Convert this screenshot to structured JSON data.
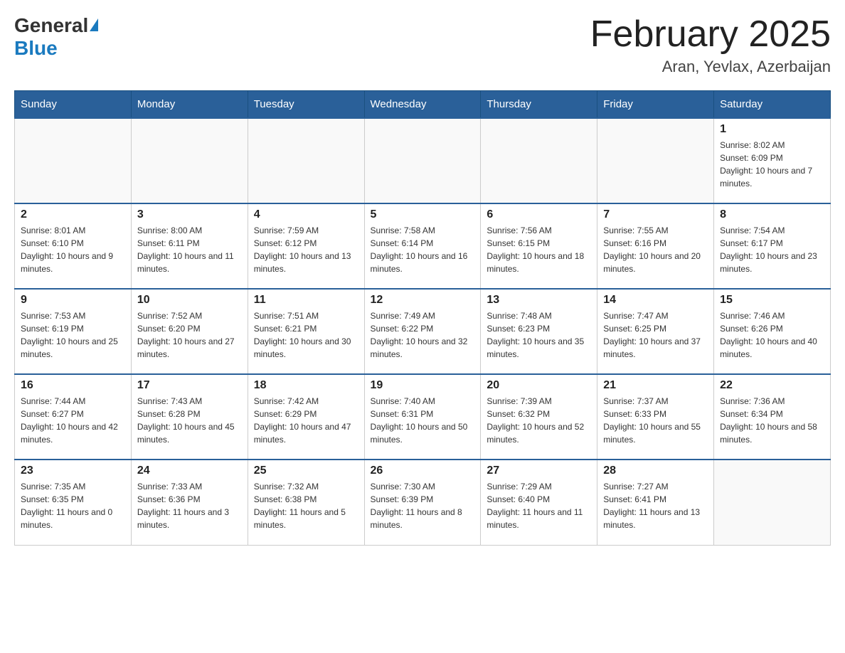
{
  "header": {
    "logo_general": "General",
    "logo_blue": "Blue",
    "title": "February 2025",
    "subtitle": "Aran, Yevlax, Azerbaijan"
  },
  "days_of_week": [
    "Sunday",
    "Monday",
    "Tuesday",
    "Wednesday",
    "Thursday",
    "Friday",
    "Saturday"
  ],
  "weeks": [
    [
      {
        "day": "",
        "info": ""
      },
      {
        "day": "",
        "info": ""
      },
      {
        "day": "",
        "info": ""
      },
      {
        "day": "",
        "info": ""
      },
      {
        "day": "",
        "info": ""
      },
      {
        "day": "",
        "info": ""
      },
      {
        "day": "1",
        "info": "Sunrise: 8:02 AM\nSunset: 6:09 PM\nDaylight: 10 hours and 7 minutes."
      }
    ],
    [
      {
        "day": "2",
        "info": "Sunrise: 8:01 AM\nSunset: 6:10 PM\nDaylight: 10 hours and 9 minutes."
      },
      {
        "day": "3",
        "info": "Sunrise: 8:00 AM\nSunset: 6:11 PM\nDaylight: 10 hours and 11 minutes."
      },
      {
        "day": "4",
        "info": "Sunrise: 7:59 AM\nSunset: 6:12 PM\nDaylight: 10 hours and 13 minutes."
      },
      {
        "day": "5",
        "info": "Sunrise: 7:58 AM\nSunset: 6:14 PM\nDaylight: 10 hours and 16 minutes."
      },
      {
        "day": "6",
        "info": "Sunrise: 7:56 AM\nSunset: 6:15 PM\nDaylight: 10 hours and 18 minutes."
      },
      {
        "day": "7",
        "info": "Sunrise: 7:55 AM\nSunset: 6:16 PM\nDaylight: 10 hours and 20 minutes."
      },
      {
        "day": "8",
        "info": "Sunrise: 7:54 AM\nSunset: 6:17 PM\nDaylight: 10 hours and 23 minutes."
      }
    ],
    [
      {
        "day": "9",
        "info": "Sunrise: 7:53 AM\nSunset: 6:19 PM\nDaylight: 10 hours and 25 minutes."
      },
      {
        "day": "10",
        "info": "Sunrise: 7:52 AM\nSunset: 6:20 PM\nDaylight: 10 hours and 27 minutes."
      },
      {
        "day": "11",
        "info": "Sunrise: 7:51 AM\nSunset: 6:21 PM\nDaylight: 10 hours and 30 minutes."
      },
      {
        "day": "12",
        "info": "Sunrise: 7:49 AM\nSunset: 6:22 PM\nDaylight: 10 hours and 32 minutes."
      },
      {
        "day": "13",
        "info": "Sunrise: 7:48 AM\nSunset: 6:23 PM\nDaylight: 10 hours and 35 minutes."
      },
      {
        "day": "14",
        "info": "Sunrise: 7:47 AM\nSunset: 6:25 PM\nDaylight: 10 hours and 37 minutes."
      },
      {
        "day": "15",
        "info": "Sunrise: 7:46 AM\nSunset: 6:26 PM\nDaylight: 10 hours and 40 minutes."
      }
    ],
    [
      {
        "day": "16",
        "info": "Sunrise: 7:44 AM\nSunset: 6:27 PM\nDaylight: 10 hours and 42 minutes."
      },
      {
        "day": "17",
        "info": "Sunrise: 7:43 AM\nSunset: 6:28 PM\nDaylight: 10 hours and 45 minutes."
      },
      {
        "day": "18",
        "info": "Sunrise: 7:42 AM\nSunset: 6:29 PM\nDaylight: 10 hours and 47 minutes."
      },
      {
        "day": "19",
        "info": "Sunrise: 7:40 AM\nSunset: 6:31 PM\nDaylight: 10 hours and 50 minutes."
      },
      {
        "day": "20",
        "info": "Sunrise: 7:39 AM\nSunset: 6:32 PM\nDaylight: 10 hours and 52 minutes."
      },
      {
        "day": "21",
        "info": "Sunrise: 7:37 AM\nSunset: 6:33 PM\nDaylight: 10 hours and 55 minutes."
      },
      {
        "day": "22",
        "info": "Sunrise: 7:36 AM\nSunset: 6:34 PM\nDaylight: 10 hours and 58 minutes."
      }
    ],
    [
      {
        "day": "23",
        "info": "Sunrise: 7:35 AM\nSunset: 6:35 PM\nDaylight: 11 hours and 0 minutes."
      },
      {
        "day": "24",
        "info": "Sunrise: 7:33 AM\nSunset: 6:36 PM\nDaylight: 11 hours and 3 minutes."
      },
      {
        "day": "25",
        "info": "Sunrise: 7:32 AM\nSunset: 6:38 PM\nDaylight: 11 hours and 5 minutes."
      },
      {
        "day": "26",
        "info": "Sunrise: 7:30 AM\nSunset: 6:39 PM\nDaylight: 11 hours and 8 minutes."
      },
      {
        "day": "27",
        "info": "Sunrise: 7:29 AM\nSunset: 6:40 PM\nDaylight: 11 hours and 11 minutes."
      },
      {
        "day": "28",
        "info": "Sunrise: 7:27 AM\nSunset: 6:41 PM\nDaylight: 11 hours and 13 minutes."
      },
      {
        "day": "",
        "info": ""
      }
    ]
  ]
}
